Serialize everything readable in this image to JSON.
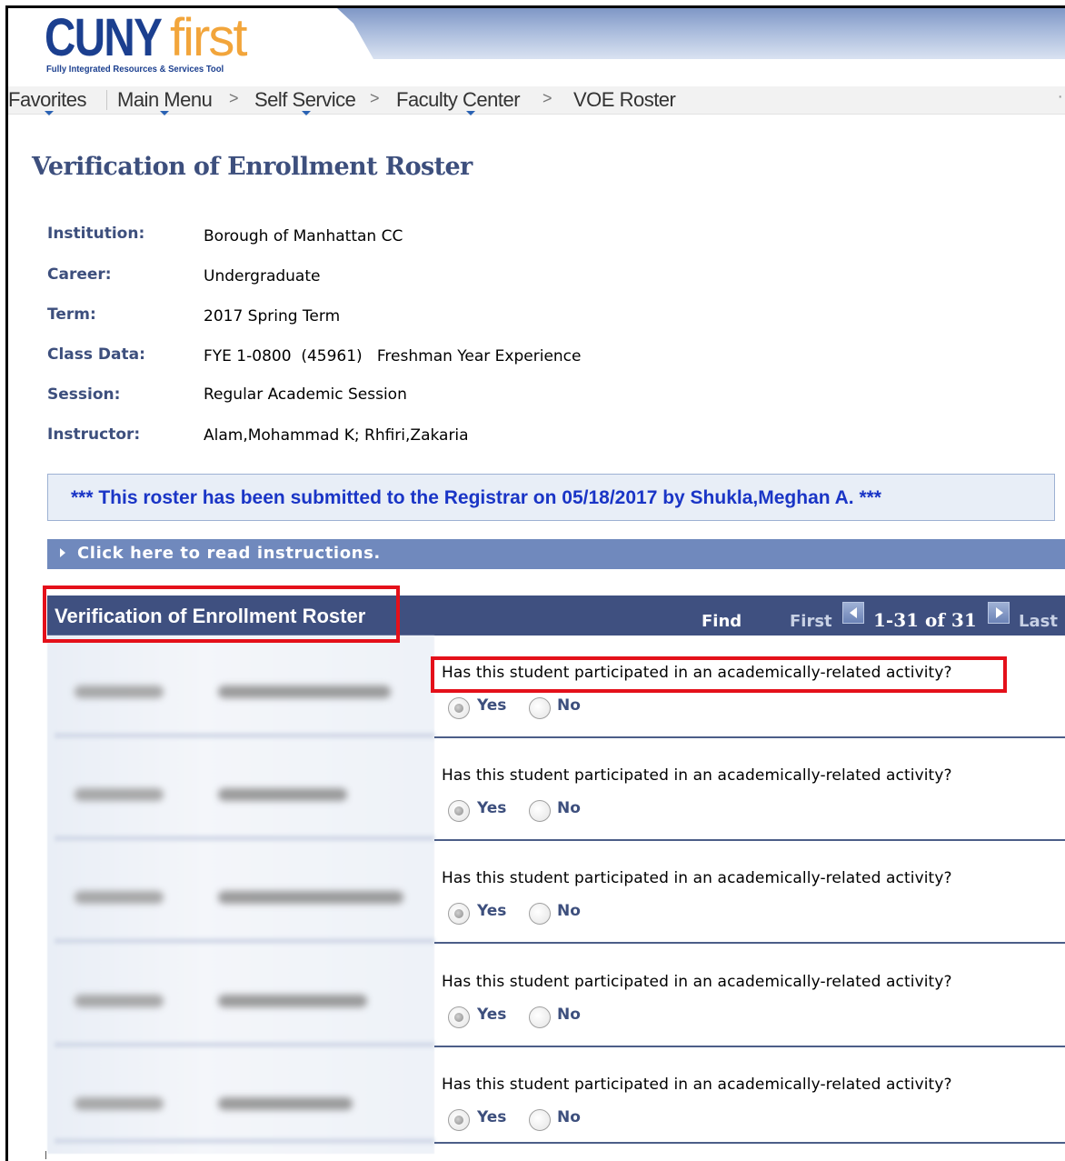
{
  "logo": {
    "main_cuny": "CUNY",
    "main_first": "first",
    "tagline": "Fully Integrated Resources & Services Tool"
  },
  "breadcrumb": {
    "items": [
      {
        "label": "Favorites"
      },
      {
        "label": "Main Menu"
      },
      {
        "label": "Self Service"
      },
      {
        "label": "Faculty Center"
      },
      {
        "label": "VOE Roster"
      }
    ],
    "separator": ">"
  },
  "page_title": "Verification of Enrollment Roster",
  "info": {
    "institution_label": "Institution:",
    "institution_value": "Borough of Manhattan CC",
    "career_label": "Career:",
    "career_value": "Undergraduate",
    "term_label": "Term:",
    "term_value": "2017 Spring Term",
    "class_label": "Class Data:",
    "class_value": "FYE 1-0800  (45961)   Freshman Year Experience",
    "session_label": "Session:",
    "session_value": "Regular Academic Session",
    "instructor_label": "Instructor:",
    "instructor_value": "Alam,Mohammad K; Rhfiri,Zakaria"
  },
  "notice": "*** This roster has been submitted to the Registrar on 05/18/2017 by Shukla,Meghan A. ***",
  "instructions_label": "Click here to read instructions.",
  "grid": {
    "title": "Verification of Enrollment Roster",
    "find": "Find",
    "first": "First",
    "count": "1-31 of 31",
    "last": "Last"
  },
  "rows": [
    {
      "question": "Has this student participated in an academically-related activity?",
      "yes": "Yes",
      "no": "No",
      "selected": "Yes"
    },
    {
      "question": "Has this student participated in an academically-related activity?",
      "yes": "Yes",
      "no": "No",
      "selected": "Yes"
    },
    {
      "question": "Has this student participated in an academically-related activity?",
      "yes": "Yes",
      "no": "No",
      "selected": "Yes"
    },
    {
      "question": "Has this student participated in an academically-related activity?",
      "yes": "Yes",
      "no": "No",
      "selected": "Yes"
    },
    {
      "question": "Has this student participated in an academically-related activity?",
      "yes": "Yes",
      "no": "No",
      "selected": "Yes"
    }
  ],
  "colors": {
    "accent_navy": "#3f5080",
    "label_blue": "#3d4f7d",
    "notice_text": "#1a35c6",
    "highlight_red": "#e4101a",
    "logo_blue": "#1b3f8f",
    "logo_orange": "#f2a53b"
  }
}
